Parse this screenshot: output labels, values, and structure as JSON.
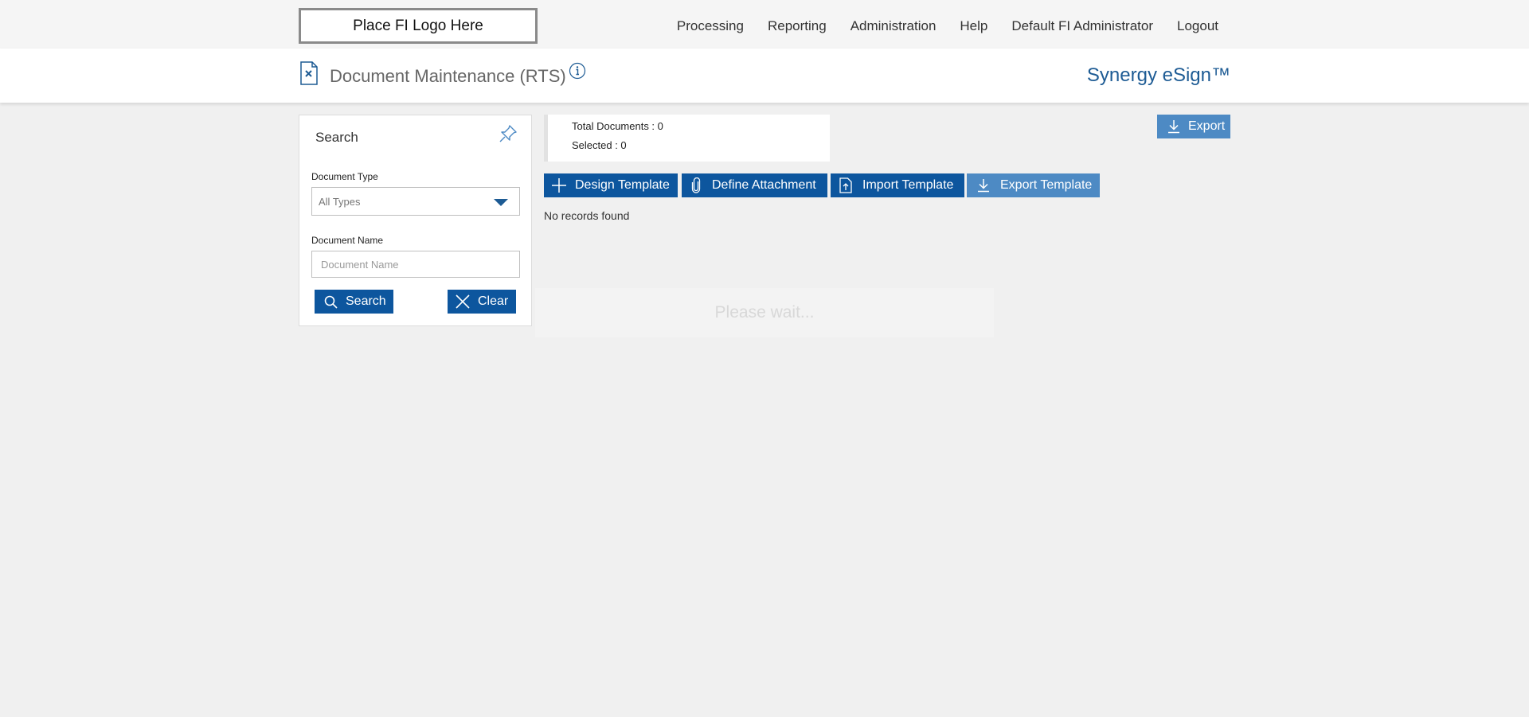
{
  "topbar": {
    "logo_text": "Place FI Logo Here",
    "nav": [
      "Processing",
      "Reporting",
      "Administration",
      "Help",
      "Default FI Administrator",
      "Logout"
    ]
  },
  "header": {
    "page_title": "Document Maintenance (RTS)",
    "brand": "Synergy eSign™"
  },
  "search": {
    "title": "Search",
    "document_type_label": "Document Type",
    "document_type_value": "All Types",
    "document_name_label": "Document Name",
    "document_name_placeholder": "Document Name",
    "search_button": "Search",
    "clear_button": "Clear"
  },
  "summary": {
    "total_documents": "Total Documents : 0",
    "selected": "Selected : 0"
  },
  "toolbar": {
    "export_button": "Export",
    "design_template": "Design Template",
    "define_attachment": "Define Attachment",
    "import_template": "Import Template",
    "export_template": "Export Template"
  },
  "results": {
    "empty_message": "No records found",
    "loading_message": "Please wait..."
  },
  "colors": {
    "accent": "#0d569e",
    "accent_disabled": "#4d8ac4",
    "brand": "#1d5b94"
  },
  "icons": [
    "document-icon",
    "info-icon",
    "pin-icon",
    "caret-down-icon",
    "search-icon",
    "close-icon",
    "plus-icon",
    "paperclip-icon",
    "upload-file-icon",
    "download-icon"
  ]
}
